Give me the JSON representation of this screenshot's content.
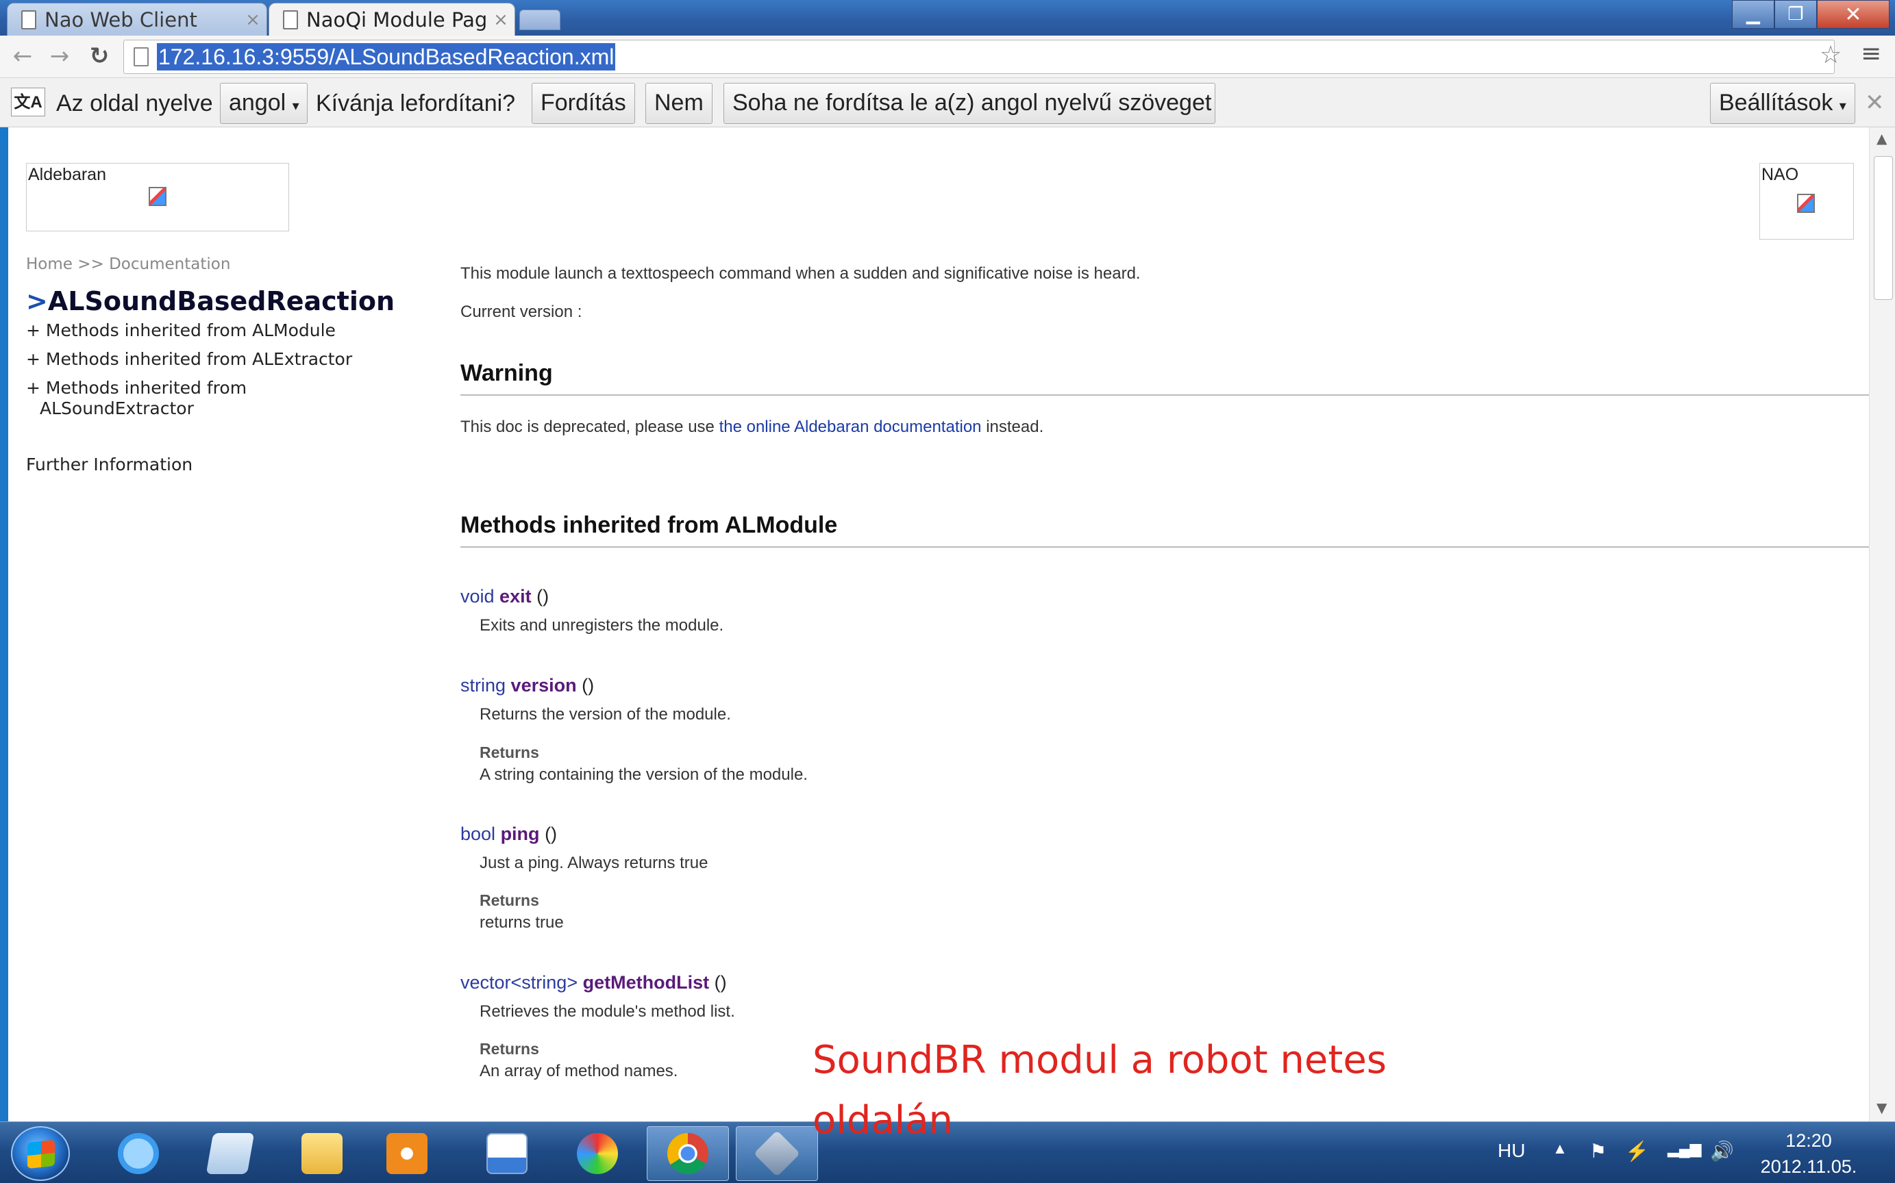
{
  "browser": {
    "tabs": [
      {
        "label": "Nao Web Client",
        "active": false
      },
      {
        "label": "NaoQi Module Page",
        "active": true
      }
    ],
    "url": "172.16.16.3:9559/ALSoundBasedReaction.xml"
  },
  "translate_bar": {
    "icon_text": "文A",
    "page_language_label": "Az oldal nyelve",
    "language": "angol",
    "question": "Kívánja lefordítani?",
    "translate_button": "Fordítás",
    "no_button": "Nem",
    "never_button": "Soha ne fordítsa le a(z) angol nyelvű szöveget",
    "settings_button": "Beállítások"
  },
  "page": {
    "logo_left": "Aldebaran",
    "logo_right": "NAO",
    "breadcrumb": "Home >> Documentation",
    "module_prefix": ">",
    "module_name": "ALSoundBasedReaction",
    "side_items": [
      "+ Methods inherited from ALModule",
      "+ Methods inherited from ALExtractor",
      "+ Methods inherited from",
      "ALSoundExtractor"
    ],
    "further_info": "Further Information",
    "intro": "This module launch a texttospeech command when a sudden and significative noise is heard.",
    "current_version": "Current version :",
    "warning_heading": "Warning",
    "warning_text_pre": "This doc is deprecated, please use",
    "warning_link": "the online Aldebaran documentation",
    "warning_text_post": "instead.",
    "methods_heading": "Methods inherited from ALModule",
    "methods": [
      {
        "ret_type": "void",
        "name": "exit",
        "params": "()",
        "desc": "Exits and unregisters the module."
      },
      {
        "ret_type": "string",
        "name": "version",
        "params": "()",
        "desc": "Returns the version of the module.",
        "returns_label": "Returns",
        "returns": "A string containing the version of the module."
      },
      {
        "ret_type": "bool",
        "name": "ping",
        "params": "()",
        "desc": "Just a ping. Always returns true",
        "returns_label": "Returns",
        "returns": "returns true"
      },
      {
        "ret_type": "vector<string>",
        "name": "getMethodList",
        "params": "()",
        "desc": "Retrieves the module's method list.",
        "returns_label": "Returns",
        "returns": "An array of method names."
      }
    ]
  },
  "overlay_caption": [
    "SoundBR modul a robot netes",
    "oldalán"
  ],
  "taskbar": {
    "language": "HU",
    "time": "12:20",
    "date": "2012.11.05."
  },
  "colors": {
    "accent_blue": "#3569c9",
    "caption_red": "#e0251f",
    "method_name": "#5a1a7a",
    "type_blue": "#2b3aa0"
  }
}
